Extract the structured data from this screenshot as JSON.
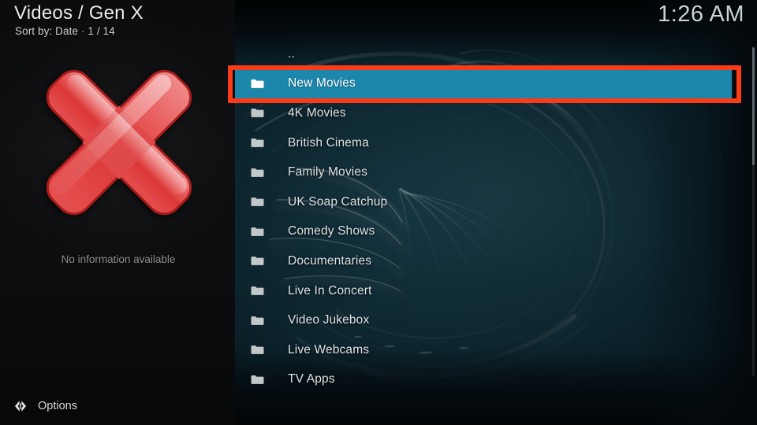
{
  "header": {
    "title": "Videos / Gen X",
    "subtitle": "Sort by: Date  ·  1 / 14",
    "clock": "1:26 AM"
  },
  "info_panel": {
    "thumbnail_icon": "red-x-icon",
    "no_info_text": "No information available"
  },
  "footer": {
    "options_icon": "left-right-arrow-icon",
    "options_label": "Options"
  },
  "file_list": {
    "selected_index": 1,
    "highlight_color": "#1d87ab",
    "annotation_color": "#fb3b17",
    "items": [
      {
        "label": "..",
        "icon": "parent-folder-icon"
      },
      {
        "label": "New Movies",
        "icon": "folder-icon"
      },
      {
        "label": "4K Movies",
        "icon": "folder-icon"
      },
      {
        "label": "British Cinema",
        "icon": "folder-icon"
      },
      {
        "label": "Family Movies",
        "icon": "folder-icon"
      },
      {
        "label": "UK Soap Catchup",
        "icon": "folder-icon"
      },
      {
        "label": "Comedy Shows",
        "icon": "folder-icon"
      },
      {
        "label": "Documentaries",
        "icon": "folder-icon"
      },
      {
        "label": "Live In Concert",
        "icon": "folder-icon"
      },
      {
        "label": "Video Jukebox",
        "icon": "folder-icon"
      },
      {
        "label": "Live Webcams",
        "icon": "folder-icon"
      },
      {
        "label": "TV Apps",
        "icon": "folder-icon"
      }
    ]
  }
}
